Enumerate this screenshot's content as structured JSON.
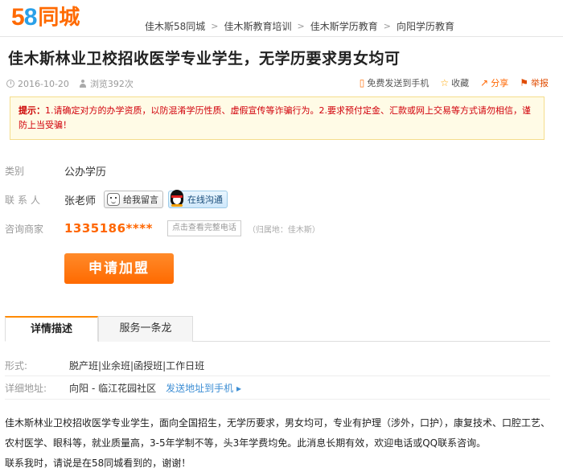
{
  "header": {
    "logo_num": "58",
    "logo_text": "同城",
    "breadcrumb": [
      "佳木斯58同城",
      "佳木斯教育培训",
      "佳木斯学历教育",
      "向阳学历教育"
    ],
    "sep": ">"
  },
  "post": {
    "title": "佳木斯林业卫校招收医学专业学生，无学历要求男女均可",
    "date": "2016-10-20",
    "views": "浏览392次"
  },
  "actions": {
    "send_phone": "免费发送到手机",
    "favorite": "收藏",
    "share": "分享",
    "report": "举报"
  },
  "notice": {
    "label": "提示：",
    "text": "1.请确定对方的办学资质，以防混淆学历性质、虚假宣传等诈骗行为。2.要求预付定金、汇款或网上交易等方式请勿相信，谨防上当受骗！"
  },
  "info": {
    "category_label": "类别",
    "category_value": "公办学历",
    "contact_label": "联系人",
    "contact_value": "张老师",
    "msg_button": "给我留言",
    "qq_button": "在线沟通",
    "consult_label": "咨询商家",
    "phone": "1335186****",
    "view_phone": "点击查看完整电话",
    "region": "（归属地：佳木斯）"
  },
  "join_button": "申请加盟",
  "tabs": [
    "详情描述",
    "服务一条龙"
  ],
  "details": {
    "form_label": "形式:",
    "form_value": "脱产班|业余班|函授班|工作日班",
    "address_label": "详细地址:",
    "address_district": "向阳",
    "address_rest": "- 临江花园社区",
    "send_address": "发送地址到手机 ▸"
  },
  "description": [
    "佳木斯林业卫校招收医学专业学生，面向全国招生，无学历要求，男女均可，专业有护理（涉外，口护），康复技术、口腔工艺、农村医学、眼科等，就业质量高，3-5年学制不等，头3年学费均免。此消息长期有效，欢迎电话或QQ联系咨询。",
    "联系我时，请说是在58同城看到的，谢谢！"
  ]
}
